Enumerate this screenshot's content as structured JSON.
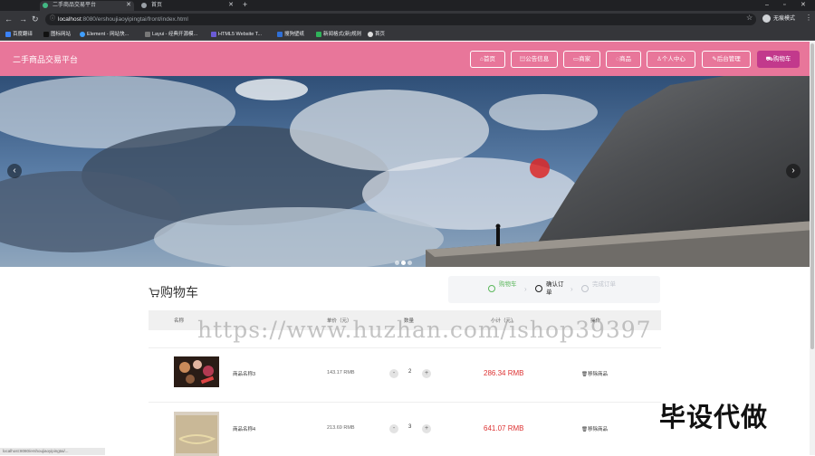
{
  "browser": {
    "tabs": [
      {
        "title": "二手商品交易平台",
        "icon": "vue-icon"
      },
      {
        "title": "首页",
        "icon": "globe-icon"
      }
    ],
    "url_host": "localhost",
    "url_rest": ":8080/ershoujiaoyipingtai/front/index.html",
    "profile_label": "无痕模式",
    "bookmarks": [
      "百度翻译",
      "图标网站",
      "Element - 网站快...",
      "Layui - 经典开源模...",
      "HTML5 Website T...",
      "搜狗壁纸",
      "新闻格式(新)规则",
      "首页"
    ]
  },
  "header": {
    "site_title": "二手商品交易平台",
    "nav": [
      {
        "label": "首页",
        "icon": "home-icon"
      },
      {
        "label": "公告信息",
        "icon": "notice-icon"
      },
      {
        "label": "商家",
        "icon": "shop-icon"
      },
      {
        "label": "商品",
        "icon": "goods-icon"
      },
      {
        "label": "个人中心",
        "icon": "user-icon"
      },
      {
        "label": "后台管理",
        "icon": "admin-icon"
      },
      {
        "label": "购物车",
        "icon": "cart-icon"
      }
    ]
  },
  "banner": {
    "slide_count": 3,
    "active_slide": 2
  },
  "cart": {
    "title": "购物车",
    "steps": [
      {
        "label": "购物车",
        "state": "done"
      },
      {
        "label": "确认订单",
        "state": "current"
      },
      {
        "label": "完成订单",
        "state": "todo"
      }
    ],
    "columns": [
      "名称",
      "单价（元）",
      "数量",
      "小计（元）",
      "操作"
    ],
    "rows": [
      {
        "name": "商品名称3",
        "price": "143.17 RMB",
        "qty": "2",
        "total": "286.34 RMB",
        "action": "移除商品"
      },
      {
        "name": "商品名称4",
        "price": "213.69 RMB",
        "qty": "3",
        "total": "641.07 RMB",
        "action": "移除商品"
      }
    ]
  },
  "watermark": "https://www.huzhan.com/ishop39397",
  "stamp": "毕设代做",
  "status_text": "localhost:8080/ershoujiaoyipingtai/...",
  "colors": {
    "header": "#e8769a",
    "cart_button": "#c2398c",
    "price": "#dd3333",
    "step_done": "#5cb85c"
  }
}
